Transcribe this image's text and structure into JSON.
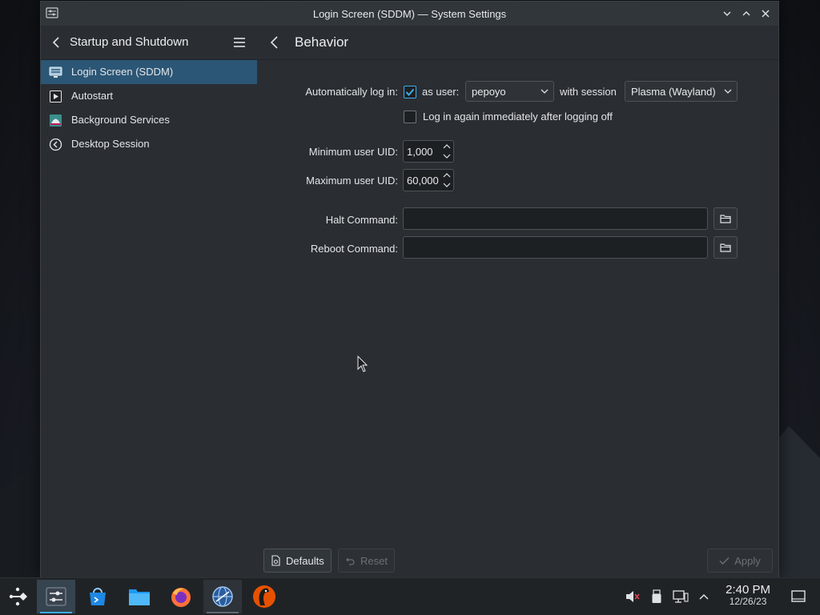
{
  "window": {
    "title": "Login Screen (SDDM) — System Settings"
  },
  "sidebar": {
    "title": "Startup and Shutdown",
    "items": [
      {
        "label": "Login Screen (SDDM)",
        "icon": "login-screen-icon",
        "active": true
      },
      {
        "label": "Autostart",
        "icon": "autostart-icon",
        "active": false
      },
      {
        "label": "Background Services",
        "icon": "background-services-icon",
        "active": false
      },
      {
        "label": "Desktop Session",
        "icon": "desktop-session-icon",
        "active": false
      }
    ]
  },
  "main": {
    "title": "Behavior",
    "autologin": {
      "label": "Automatically log in:",
      "checked": true,
      "as_user_label": "as user:",
      "user_value": "pepoyo",
      "with_session_label": "with session",
      "session_value": "Plasma (Wayland)",
      "relogin_label": "Log in again immediately after logging off",
      "relogin_checked": false
    },
    "min_uid": {
      "label": "Minimum user UID:",
      "value": "1,000"
    },
    "max_uid": {
      "label": "Maximum user UID:",
      "value": "60,000"
    },
    "halt": {
      "label": "Halt Command:",
      "value": ""
    },
    "reboot": {
      "label": "Reboot Command:",
      "value": ""
    }
  },
  "footer": {
    "defaults_label": "Defaults",
    "reset_label": "Reset",
    "apply_label": "Apply"
  },
  "taskbar": {
    "apps": [
      {
        "name": "application-launcher",
        "state": "normal"
      },
      {
        "name": "system-settings",
        "state": "active"
      },
      {
        "name": "discover",
        "state": "normal"
      },
      {
        "name": "dolphin-file-manager",
        "state": "normal"
      },
      {
        "name": "firefox",
        "state": "normal"
      },
      {
        "name": "web-browser",
        "state": "running"
      },
      {
        "name": "app-penguin",
        "state": "normal"
      }
    ],
    "clock": {
      "time": "2:40 PM",
      "date": "12/26/23"
    }
  },
  "colors": {
    "accent": "#3daee9",
    "selection": "#2b5675",
    "window_bg": "#2a2e32"
  }
}
